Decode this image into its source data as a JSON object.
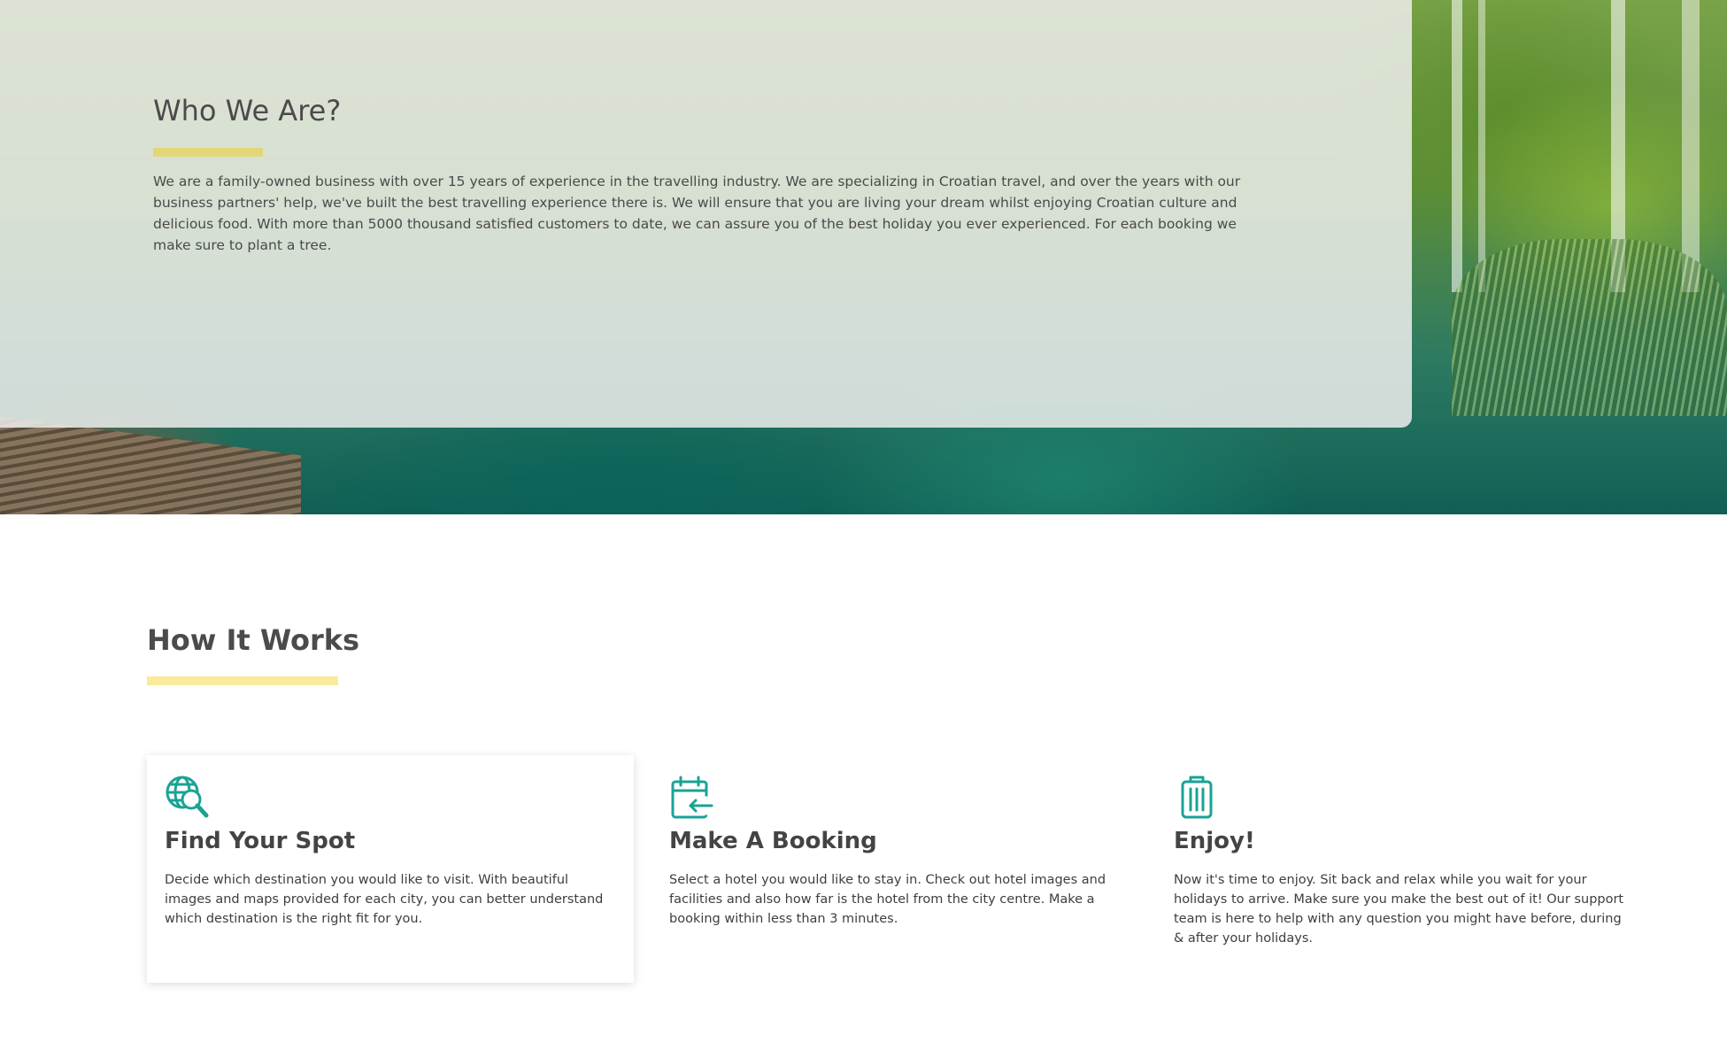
{
  "about": {
    "title": "Who We Are?",
    "text": "We are a family-owned business with over 15 years of experience in the travelling industry. We are specializing in Croatian travel, and over the years with our business partners' help, we've built the best travelling experience there is. We will ensure that you are living your dream whilst enjoying Croatian culture and delicious food. With more than 5000 thousand satisfied customers to date, we can assure you of the best holiday you ever experienced. For each booking we make sure to plant a tree."
  },
  "how_it_works": {
    "title": "How It Works",
    "steps": [
      {
        "icon": "globe-search-icon",
        "title": "Find Your Spot",
        "text": "Decide which destination you would like to visit. With beautiful images and maps provided for each city, you can better understand which destination is the right fit for you."
      },
      {
        "icon": "calendar-arrow-icon",
        "title": "Make A Booking",
        "text": "Select a hotel you would like to stay in. Check out hotel images and facilities and also how far is the hotel from the city centre. Make a booking within less than 3 minutes."
      },
      {
        "icon": "suitcase-icon",
        "title": "Enjoy!",
        "text": "Now it's time to enjoy. Sit back and relax while you wait for your holidays to arrive. Make sure you make the best out of it! Our support team is here to help with any question you might have before, during & after your holidays."
      }
    ]
  },
  "colors": {
    "accent_teal": "#19a394",
    "underline_yellow": "#faeb9a",
    "panel_underline": "#e3d46a"
  }
}
